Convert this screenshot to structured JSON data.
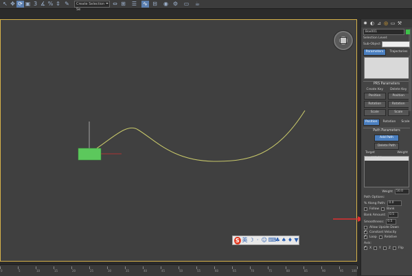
{
  "toolbar": {
    "selection_set": "Create Selection Se",
    "icons": [
      "select-icon",
      "move-icon",
      "rotate-icon",
      "scale-icon",
      "snap-icon",
      "angle-snap-icon",
      "percent-snap-icon",
      "spinner-snap-icon",
      "edit-named-icon",
      "mirror-icon",
      "align-icon",
      "layer-icon",
      "curve-editor-icon",
      "schematic-icon",
      "material-icon",
      "render-setup-icon",
      "render-frame-icon",
      "render-icon"
    ]
  },
  "viewport": {
    "path_color": "#c8c86a",
    "box_color": "#5cc85c"
  },
  "floatbar": {
    "logo": "S",
    "items": [
      "英",
      "☽",
      "·",
      "☺",
      "⌨",
      "♣",
      "♠",
      "♦",
      "▼",
      "✎"
    ]
  },
  "ruler": {
    "labels": [
      "0",
      "5",
      "10",
      "15",
      "20",
      "25",
      "30",
      "35",
      "40",
      "45",
      "50",
      "55",
      "60",
      "65",
      "70",
      "75",
      "80",
      "85",
      "90",
      "95",
      "100"
    ]
  },
  "panel": {
    "object_name": "Box001",
    "selection_level_label": "Selection Level:",
    "sub_object_label": "Sub-Object",
    "tab_parameters": "Parameters",
    "tab_trajectories": "Trajectories",
    "list_item": "",
    "prs_title": "PRS Parameters",
    "create_key": "Create Key",
    "delete_key": "Delete Key",
    "position": "Position",
    "rotation": "Rotation",
    "scale": "Scale",
    "sub_position": "Position",
    "sub_rotation": "Rotation",
    "sub_scale": "Scale",
    "path_params_title": "Path Parameters",
    "add_path": "Add Path",
    "delete_path": "Delete Path",
    "col_target": "Target",
    "col_weight": "Weight",
    "target_name": "Line001",
    "target_weight": "50",
    "weight_label": "Weight",
    "weight_value": "50.0",
    "path_options": "Path Options:",
    "along_path_label": "% Along Path:",
    "along_path_value": "0.0",
    "follow_label": "Follow",
    "bank_label": "Bank",
    "bank_amount_label": "Bank Amount:",
    "bank_amount_value": "0.5",
    "smoothness_label": "Smoothness:",
    "smoothness_value": "0.5",
    "allow_upside_label": "Allow Upside Down",
    "constant_velocity_label": "Constant Velocity",
    "loop_label": "Loop",
    "relative_label": "Relative",
    "axis_label": "Axis:",
    "axis_x": "X",
    "axis_y": "Y",
    "axis_z": "Z",
    "flip_label": "Flip"
  }
}
